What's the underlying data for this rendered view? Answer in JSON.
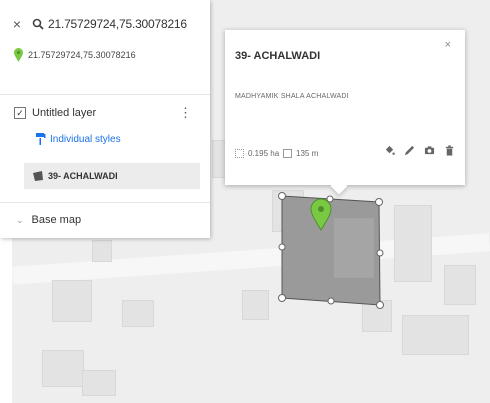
{
  "search": {
    "close_label": "×",
    "query": "21.75729724,75.30078216",
    "coordinate_text": "21.75729724,75.30078216"
  },
  "layer": {
    "checkbox_mark": "✓",
    "name": "Untitled layer",
    "menu_glyph": "⋮",
    "styles_link": "Individual styles",
    "feature_label": "39- ACHALWADI"
  },
  "basemap": {
    "chevron_glyph": "⌄",
    "label": "Base map"
  },
  "popup": {
    "title": "39- ACHALWADI",
    "close_label": "×",
    "description": "MADHYAMIK SHALA ACHALWADI",
    "area": "0.195 ha",
    "perimeter": "135 m"
  },
  "colors": {
    "polygon_fill": "#9a9a9a",
    "pin_green": "#7ac943",
    "link_blue": "#1a73e8",
    "map_bg": "#eeeeee"
  },
  "icons": [
    "close-icon",
    "search-icon",
    "pin-icon",
    "kebab-icon",
    "paint-icon",
    "polygon-icon",
    "paint-bucket-icon",
    "pencil-icon",
    "camera-icon",
    "trash-icon"
  ]
}
